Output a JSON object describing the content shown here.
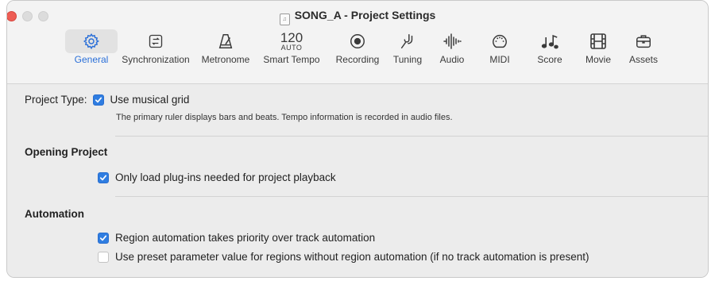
{
  "window": {
    "title": "SONG_A - Project Settings"
  },
  "toolbar": {
    "tabs": [
      {
        "label": "General",
        "icon": "gear-icon",
        "active": true
      },
      {
        "label": "Synchronization",
        "icon": "sync-icon"
      },
      {
        "label": "Metronome",
        "icon": "metronome-icon"
      },
      {
        "label": "Smart Tempo",
        "icon": "tempo-icon",
        "tempo": "120",
        "tempo_mode": "AUTO"
      },
      {
        "label": "Recording",
        "icon": "record-icon"
      },
      {
        "label": "Tuning",
        "icon": "tuning-fork-icon"
      },
      {
        "label": "Audio",
        "icon": "waveform-icon"
      },
      {
        "label": "MIDI",
        "icon": "midi-port-icon"
      },
      {
        "label": "Score",
        "icon": "notes-icon"
      },
      {
        "label": "Movie",
        "icon": "film-icon"
      },
      {
        "label": "Assets",
        "icon": "briefcase-icon"
      }
    ]
  },
  "general": {
    "project_type_label": "Project Type:",
    "musical_grid_label": "Use musical grid",
    "musical_grid_checked": true,
    "musical_grid_desc": "The primary ruler displays bars and beats. Tempo information is recorded in audio files.",
    "opening_project_title": "Opening Project",
    "only_load_label": "Only load plug-ins needed for project playback",
    "only_load_checked": true,
    "automation_title": "Automation",
    "region_priority_label": "Region automation takes priority over track automation",
    "region_priority_checked": true,
    "preset_param_label": "Use preset parameter value for regions without region automation (if no track automation is present)",
    "preset_param_checked": false
  },
  "colors": {
    "accent": "#2f7de1",
    "close": "#ee5d54"
  }
}
